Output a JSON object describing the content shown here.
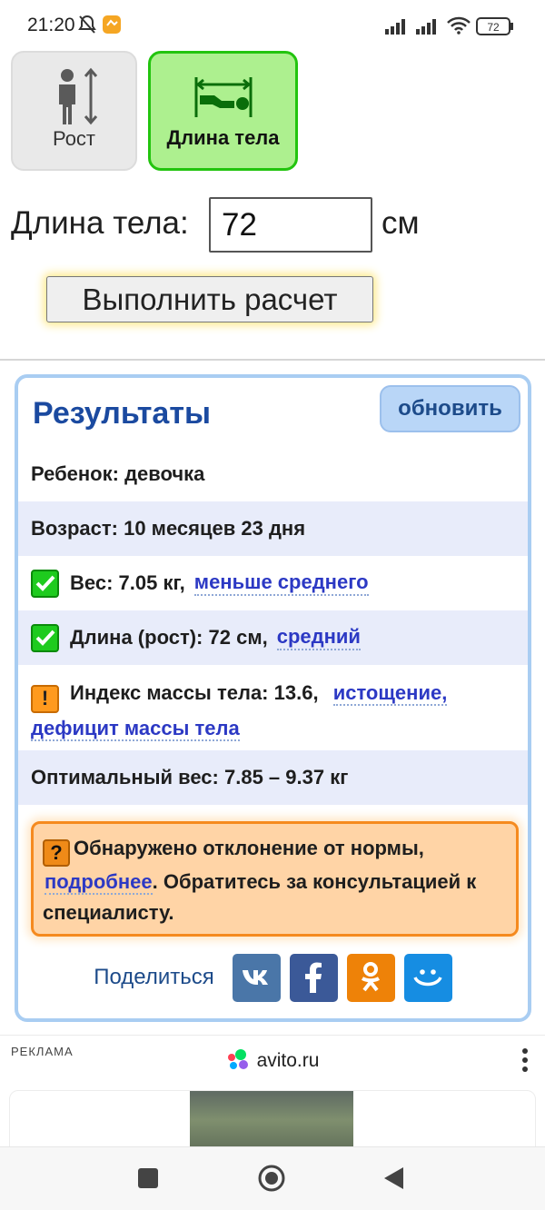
{
  "status": {
    "time": "21:20",
    "battery": "72"
  },
  "modes": {
    "rost_label": "Рост",
    "length_label": "Длина тела"
  },
  "form": {
    "label": "Длина тела:",
    "value": "72",
    "unit": "см",
    "calc_button": "Выполнить расчет"
  },
  "results": {
    "title": "Результаты",
    "refresh": "обновить",
    "child": "Ребенок: девочка",
    "age": "Возраст: 10 месяцев 23 дня",
    "weight_text": "Вес: 7.05 кг,",
    "weight_link": "меньше среднего",
    "length_text": "Длина (рост): 72 см,",
    "length_link": "средний",
    "bmi_text": "Индекс массы тела: 13.6,",
    "bmi_link1": "истощение,",
    "bmi_link2": "дефицит массы тела",
    "optimal": "Оптимальный вес: 7.85 – 9.37 кг",
    "alert_part1": "Обнаружено отклонение от нормы,",
    "alert_link": "подробнее",
    "alert_part2": ". Обратитесь за консультацией к специалисту.",
    "share_label": "Поделиться"
  },
  "ad": {
    "label": "РЕКЛАМА",
    "site": "avito.ru"
  },
  "colors": {
    "active_green": "#adf08f",
    "title_blue": "#1b4aa0",
    "link_blue": "#2c39c4",
    "alert_orange": "#ffd4a6"
  }
}
